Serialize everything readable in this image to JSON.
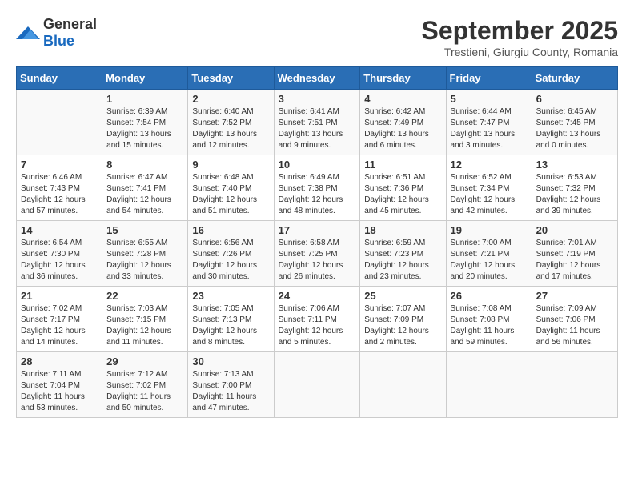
{
  "logo": {
    "text_general": "General",
    "text_blue": "Blue"
  },
  "title": {
    "month": "September 2025",
    "location": "Trestieni, Giurgiu County, Romania"
  },
  "weekdays": [
    "Sunday",
    "Monday",
    "Tuesday",
    "Wednesday",
    "Thursday",
    "Friday",
    "Saturday"
  ],
  "weeks": [
    [
      {
        "day": "",
        "info": ""
      },
      {
        "day": "1",
        "info": "Sunrise: 6:39 AM\nSunset: 7:54 PM\nDaylight: 13 hours\nand 15 minutes."
      },
      {
        "day": "2",
        "info": "Sunrise: 6:40 AM\nSunset: 7:52 PM\nDaylight: 13 hours\nand 12 minutes."
      },
      {
        "day": "3",
        "info": "Sunrise: 6:41 AM\nSunset: 7:51 PM\nDaylight: 13 hours\nand 9 minutes."
      },
      {
        "day": "4",
        "info": "Sunrise: 6:42 AM\nSunset: 7:49 PM\nDaylight: 13 hours\nand 6 minutes."
      },
      {
        "day": "5",
        "info": "Sunrise: 6:44 AM\nSunset: 7:47 PM\nDaylight: 13 hours\nand 3 minutes."
      },
      {
        "day": "6",
        "info": "Sunrise: 6:45 AM\nSunset: 7:45 PM\nDaylight: 13 hours\nand 0 minutes."
      }
    ],
    [
      {
        "day": "7",
        "info": "Sunrise: 6:46 AM\nSunset: 7:43 PM\nDaylight: 12 hours\nand 57 minutes."
      },
      {
        "day": "8",
        "info": "Sunrise: 6:47 AM\nSunset: 7:41 PM\nDaylight: 12 hours\nand 54 minutes."
      },
      {
        "day": "9",
        "info": "Sunrise: 6:48 AM\nSunset: 7:40 PM\nDaylight: 12 hours\nand 51 minutes."
      },
      {
        "day": "10",
        "info": "Sunrise: 6:49 AM\nSunset: 7:38 PM\nDaylight: 12 hours\nand 48 minutes."
      },
      {
        "day": "11",
        "info": "Sunrise: 6:51 AM\nSunset: 7:36 PM\nDaylight: 12 hours\nand 45 minutes."
      },
      {
        "day": "12",
        "info": "Sunrise: 6:52 AM\nSunset: 7:34 PM\nDaylight: 12 hours\nand 42 minutes."
      },
      {
        "day": "13",
        "info": "Sunrise: 6:53 AM\nSunset: 7:32 PM\nDaylight: 12 hours\nand 39 minutes."
      }
    ],
    [
      {
        "day": "14",
        "info": "Sunrise: 6:54 AM\nSunset: 7:30 PM\nDaylight: 12 hours\nand 36 minutes."
      },
      {
        "day": "15",
        "info": "Sunrise: 6:55 AM\nSunset: 7:28 PM\nDaylight: 12 hours\nand 33 minutes."
      },
      {
        "day": "16",
        "info": "Sunrise: 6:56 AM\nSunset: 7:26 PM\nDaylight: 12 hours\nand 30 minutes."
      },
      {
        "day": "17",
        "info": "Sunrise: 6:58 AM\nSunset: 7:25 PM\nDaylight: 12 hours\nand 26 minutes."
      },
      {
        "day": "18",
        "info": "Sunrise: 6:59 AM\nSunset: 7:23 PM\nDaylight: 12 hours\nand 23 minutes."
      },
      {
        "day": "19",
        "info": "Sunrise: 7:00 AM\nSunset: 7:21 PM\nDaylight: 12 hours\nand 20 minutes."
      },
      {
        "day": "20",
        "info": "Sunrise: 7:01 AM\nSunset: 7:19 PM\nDaylight: 12 hours\nand 17 minutes."
      }
    ],
    [
      {
        "day": "21",
        "info": "Sunrise: 7:02 AM\nSunset: 7:17 PM\nDaylight: 12 hours\nand 14 minutes."
      },
      {
        "day": "22",
        "info": "Sunrise: 7:03 AM\nSunset: 7:15 PM\nDaylight: 12 hours\nand 11 minutes."
      },
      {
        "day": "23",
        "info": "Sunrise: 7:05 AM\nSunset: 7:13 PM\nDaylight: 12 hours\nand 8 minutes."
      },
      {
        "day": "24",
        "info": "Sunrise: 7:06 AM\nSunset: 7:11 PM\nDaylight: 12 hours\nand 5 minutes."
      },
      {
        "day": "25",
        "info": "Sunrise: 7:07 AM\nSunset: 7:09 PM\nDaylight: 12 hours\nand 2 minutes."
      },
      {
        "day": "26",
        "info": "Sunrise: 7:08 AM\nSunset: 7:08 PM\nDaylight: 11 hours\nand 59 minutes."
      },
      {
        "day": "27",
        "info": "Sunrise: 7:09 AM\nSunset: 7:06 PM\nDaylight: 11 hours\nand 56 minutes."
      }
    ],
    [
      {
        "day": "28",
        "info": "Sunrise: 7:11 AM\nSunset: 7:04 PM\nDaylight: 11 hours\nand 53 minutes."
      },
      {
        "day": "29",
        "info": "Sunrise: 7:12 AM\nSunset: 7:02 PM\nDaylight: 11 hours\nand 50 minutes."
      },
      {
        "day": "30",
        "info": "Sunrise: 7:13 AM\nSunset: 7:00 PM\nDaylight: 11 hours\nand 47 minutes."
      },
      {
        "day": "",
        "info": ""
      },
      {
        "day": "",
        "info": ""
      },
      {
        "day": "",
        "info": ""
      },
      {
        "day": "",
        "info": ""
      }
    ]
  ]
}
